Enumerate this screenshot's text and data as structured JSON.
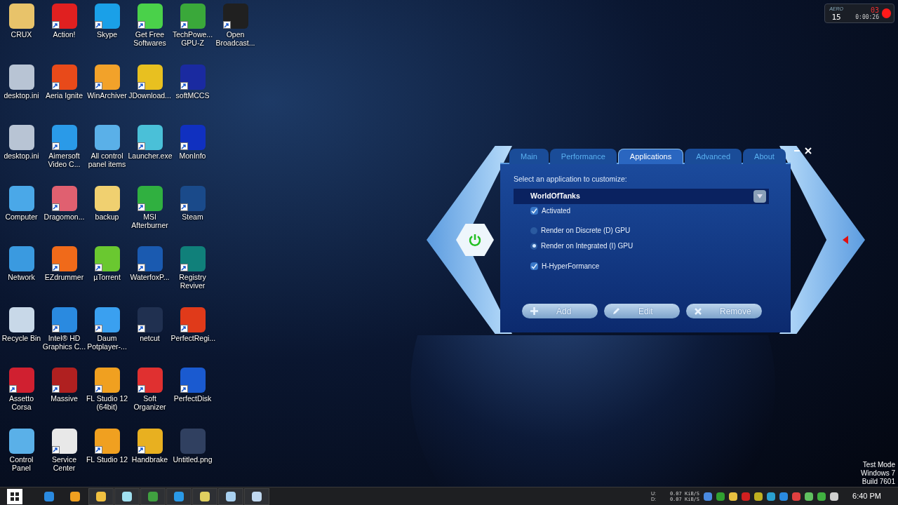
{
  "desktop_icons": [
    [
      {
        "label": "CRUX",
        "color": "#e8c36a",
        "shortcut": false
      },
      {
        "label": "Action!",
        "color": "#e02020",
        "shortcut": true
      },
      {
        "label": "Skype",
        "color": "#1aa0e8",
        "shortcut": true
      },
      {
        "label": "Get Free Softwares",
        "color": "#4ad14a",
        "shortcut": true
      },
      {
        "label": "TechPowe... GPU-Z",
        "color": "#3aa83a",
        "shortcut": true
      },
      {
        "label": "Open Broadcast...",
        "color": "#202020",
        "shortcut": true
      }
    ],
    [
      {
        "label": "desktop.ini",
        "color": "#b8c4d4",
        "shortcut": false
      },
      {
        "label": "Aeria Ignite",
        "color": "#e84a1a",
        "shortcut": true
      },
      {
        "label": "WinArchiver",
        "color": "#f2a22a",
        "shortcut": true
      },
      {
        "label": "JDownload...",
        "color": "#e8c020",
        "shortcut": true
      },
      {
        "label": "softMCCS",
        "color": "#1a2aa0",
        "shortcut": true
      }
    ],
    [
      {
        "label": "desktop.ini",
        "color": "#b8c4d4",
        "shortcut": false
      },
      {
        "label": "Aimersoft Video C...",
        "color": "#2a9ae8",
        "shortcut": true
      },
      {
        "label": "All control panel items",
        "color": "#5ab0e8",
        "shortcut": false
      },
      {
        "label": "Launcher.exe",
        "color": "#4ac0d8",
        "shortcut": true
      },
      {
        "label": "MonInfo",
        "color": "#1030c0",
        "shortcut": true
      }
    ],
    [
      {
        "label": "Computer",
        "color": "#4aa8e8",
        "shortcut": false
      },
      {
        "label": "Dragomon...",
        "color": "#e06070",
        "shortcut": true
      },
      {
        "label": "backup",
        "color": "#f0d070",
        "shortcut": false
      },
      {
        "label": "MSI Afterburner",
        "color": "#30b040",
        "shortcut": true
      },
      {
        "label": "Steam",
        "color": "#1a4a8a",
        "shortcut": true
      }
    ],
    [
      {
        "label": "Network",
        "color": "#3a9ae0",
        "shortcut": false
      },
      {
        "label": "EZdrummer",
        "color": "#f06a1a",
        "shortcut": true
      },
      {
        "label": "µTorrent",
        "color": "#6ac830",
        "shortcut": true
      },
      {
        "label": "WaterfoxP...",
        "color": "#1a5ab0",
        "shortcut": true
      },
      {
        "label": "Registry Reviver",
        "color": "#10807a",
        "shortcut": true
      }
    ],
    [
      {
        "label": "Recycle Bin",
        "color": "#c8d8e8",
        "shortcut": false
      },
      {
        "label": "Intel® HD Graphics C...",
        "color": "#2a8ae0",
        "shortcut": true
      },
      {
        "label": "Daum Potplayer-...",
        "color": "#3aa0f0",
        "shortcut": true
      },
      {
        "label": "netcut",
        "color": "#203050",
        "shortcut": true
      },
      {
        "label": "PerfectRegi...",
        "color": "#e03a1a",
        "shortcut": true
      }
    ],
    [
      {
        "label": "Assetto Corsa",
        "color": "#d02030",
        "shortcut": true
      },
      {
        "label": "Massive",
        "color": "#b02020",
        "shortcut": true
      },
      {
        "label": "FL Studio 12 (64bit)",
        "color": "#f0a020",
        "shortcut": true
      },
      {
        "label": "Soft Organizer",
        "color": "#e03030",
        "shortcut": true
      },
      {
        "label": "PerfectDisk",
        "color": "#1a5ad0",
        "shortcut": true
      }
    ],
    [
      {
        "label": "Control Panel",
        "color": "#5ab0e8",
        "shortcut": false
      },
      {
        "label": "Service Center",
        "color": "#e8e8e8",
        "shortcut": true
      },
      {
        "label": "FL Studio 12",
        "color": "#f0a020",
        "shortcut": true
      },
      {
        "label": "Handbrake",
        "color": "#e8b020",
        "shortcut": true
      },
      {
        "label": "Untitled.png",
        "color": "#304060",
        "shortcut": false
      }
    ]
  ],
  "recorder_widget": {
    "mode": "AERO",
    "fps": "15",
    "count": "03",
    "time": "0:00:26",
    "recording": true
  },
  "app_window": {
    "tabs": [
      {
        "label": "Main",
        "selected": false
      },
      {
        "label": "Performance",
        "selected": false
      },
      {
        "label": "Applications",
        "selected": true
      },
      {
        "label": "Advanced",
        "selected": false
      },
      {
        "label": "About",
        "selected": false
      }
    ],
    "prompt": "Select an application to customize:",
    "dropdown": {
      "value": "WorldOfTanks"
    },
    "options": [
      {
        "kind": "checkbox",
        "label": "Activated",
        "checked": true
      },
      {
        "kind": "radio",
        "label": "Render on Discrete (D) GPU",
        "selected": false
      },
      {
        "kind": "radio",
        "label": "Render on Integrated (I) GPU",
        "selected": true
      },
      {
        "kind": "checkbox",
        "label": "H-HyperFormance",
        "checked": true
      }
    ],
    "buttons": [
      {
        "kind": "add",
        "label": "Add"
      },
      {
        "kind": "edit",
        "label": "Edit"
      },
      {
        "kind": "remove",
        "label": "Remove"
      }
    ]
  },
  "os_notice": [
    "Test Mode",
    "Windows 7",
    "Build 7601"
  ],
  "taskbar": {
    "pinned": [
      {
        "color": "#2a8ae0"
      },
      {
        "color": "#f0a020"
      },
      {
        "color": "#f0c040"
      },
      {
        "color": "#a0e0f0"
      },
      {
        "color": "#40a040"
      },
      {
        "color": "#2a9ae8"
      },
      {
        "color": "#e0d060"
      },
      {
        "color": "#a8d0f0"
      },
      {
        "color": "#c0d8f0"
      }
    ],
    "net_meter": {
      "up_label": "U:",
      "down_label": "D:",
      "up": "0.07 KiB/S",
      "down": "0.07 KiB/S"
    },
    "tray": [
      {
        "color": "#4a8ae0"
      },
      {
        "color": "#30a030"
      },
      {
        "color": "#e8c040"
      },
      {
        "color": "#d02020"
      },
      {
        "color": "#c0b020"
      },
      {
        "color": "#2aa0d0"
      },
      {
        "color": "#2a8ae0"
      },
      {
        "color": "#e04040"
      },
      {
        "color": "#60c060"
      },
      {
        "color": "#40b040"
      },
      {
        "color": "#d0d0d0"
      }
    ],
    "clock": "6:40 PM"
  }
}
